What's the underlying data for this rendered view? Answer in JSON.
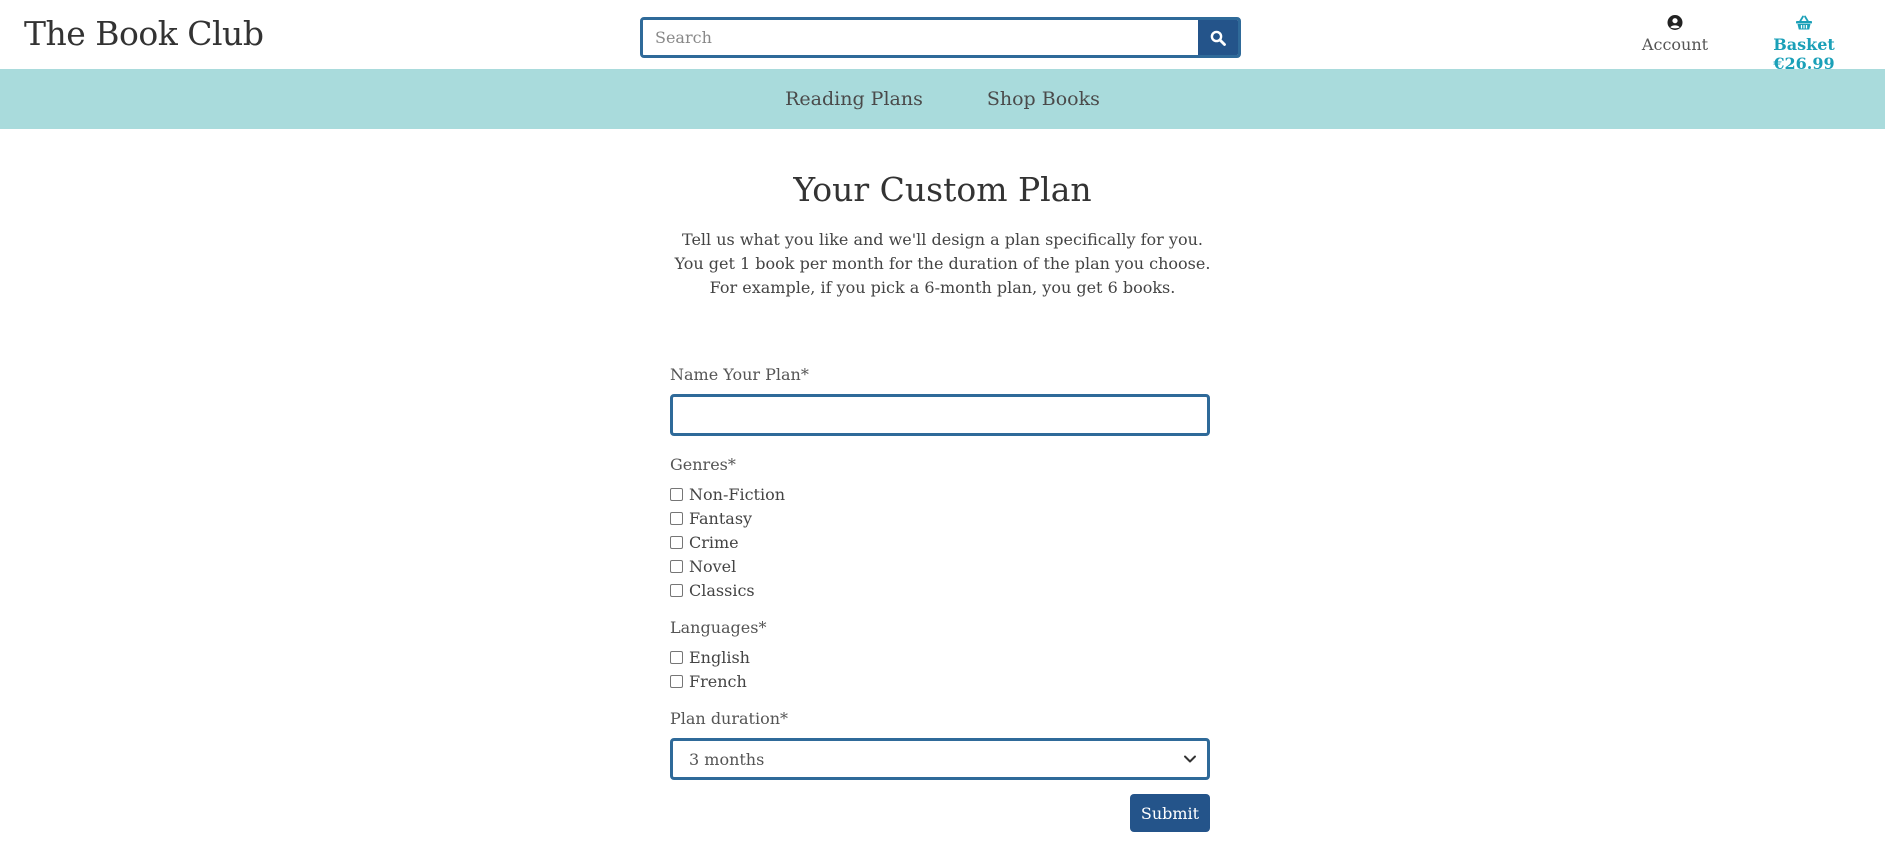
{
  "header": {
    "logo": "The Book Club",
    "search_placeholder": "Search",
    "account_label": "Account",
    "basket_label": "Basket €26.99"
  },
  "icons": {
    "search": "search-icon",
    "account": "user-circle-icon",
    "basket": "basket-icon"
  },
  "nav": {
    "items": [
      "Reading Plans",
      "Shop Books"
    ]
  },
  "main": {
    "title": "Your Custom Plan",
    "intro_lines": [
      "Tell us what you like and we'll design a plan specifically for you.",
      "You get 1 book per month for the duration of the plan you choose.",
      "For example, if you pick a 6-month plan, you get 6 books."
    ]
  },
  "form": {
    "name_label": "Name Your Plan*",
    "name_value": "",
    "genres_label": "Genres*",
    "genres": [
      "Non-Fiction",
      "Fantasy",
      "Crime",
      "Novel",
      "Classics"
    ],
    "languages_label": "Languages*",
    "languages": [
      "English",
      "French"
    ],
    "duration_label": "Plan duration*",
    "duration_selected": "3 months",
    "submit_label": "Submit"
  },
  "colors": {
    "nav_bg": "#a9dbdc",
    "primary": "#24548a",
    "border": "#2f6a99",
    "basket": "#1ba0b8"
  }
}
